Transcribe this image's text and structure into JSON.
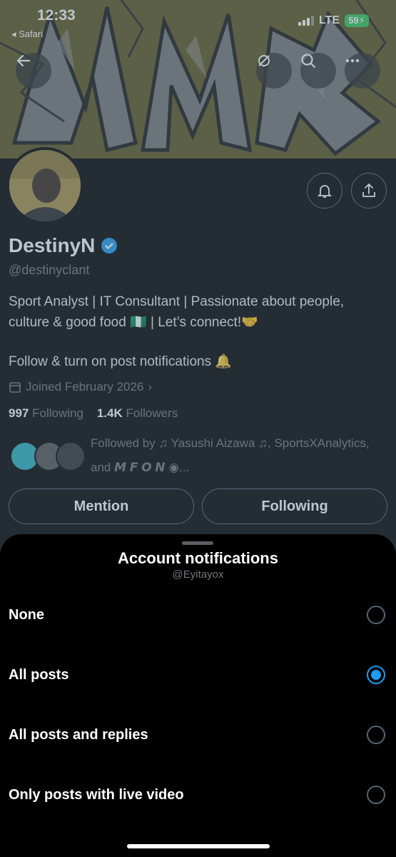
{
  "status_bar": {
    "time": "12:33",
    "back_app": "◂ Safari",
    "network": "LTE",
    "battery": "59"
  },
  "header_icons": [
    "back-arrow-icon",
    "grok-icon",
    "search-icon",
    "more-icon"
  ],
  "profile": {
    "name": "DestinyN",
    "handle": "@destinyclant",
    "bio": "Sport Analyst | IT Consultant | Passionate about people, culture & good food 🇳🇬 | Let’s connect!🤝",
    "bio_line2": "Follow & turn on post notifications 🔔",
    "joined": "Joined February 2026",
    "following_count": "997",
    "following_label": "Following",
    "followers_count": "1.4K",
    "followers_label": "Followers",
    "followed_by": "Followed by ♫ Yasushi Aizawa ♫, SportsXAnalytics, and 𝙈 𝙁 𝙊 𝙉 ◉..."
  },
  "actions": {
    "mention": "Mention",
    "following": "Following"
  },
  "sheet": {
    "title": "Account notifications",
    "subtitle": "@Eyitayox",
    "options": [
      {
        "label": "None",
        "selected": false
      },
      {
        "label": "All posts",
        "selected": true
      },
      {
        "label": "All posts and replies",
        "selected": false
      },
      {
        "label": "Only posts with live video",
        "selected": false
      }
    ]
  },
  "colors": {
    "accent": "#1d9bf0",
    "banner": "#6f6425",
    "battery": "#34c759"
  }
}
